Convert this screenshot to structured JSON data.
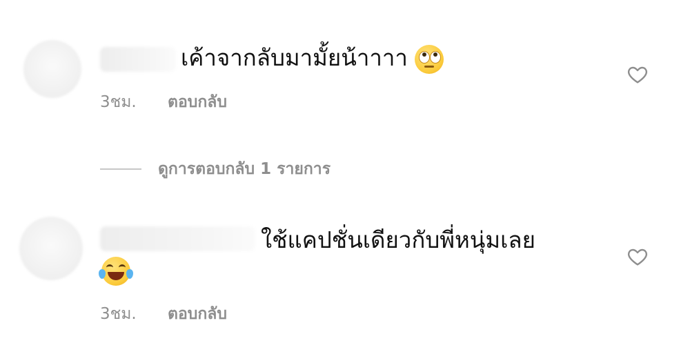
{
  "comments": [
    {
      "text": "เค้าจากลับมามั้ยน้าาาา",
      "emoji": "eye-roll-emoji",
      "time": "3ชม.",
      "reply_label": "ตอบกลับ"
    },
    {
      "text": "ใช้แคปชั่นเดียวกับพี่หนุ่มเลย",
      "emoji": "laughing-tears-emoji",
      "time": "3ชม.",
      "reply_label": "ตอบกลับ"
    }
  ],
  "view_replies": {
    "label": "ดูการตอบกลับ 1 รายการ"
  },
  "icons": {
    "like": "heart-outline-icon"
  },
  "colors": {
    "text": "#111111",
    "secondary": "#8e8e8e",
    "divider": "#c7c7c7"
  }
}
